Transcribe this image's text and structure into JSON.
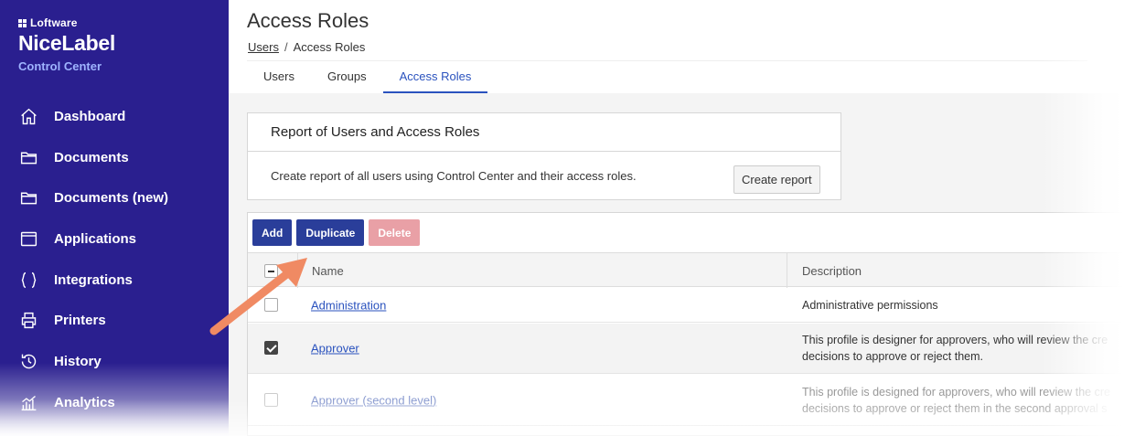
{
  "brand": {
    "company": "Loftware",
    "product": "NiceLabel",
    "subtitle": "Control Center"
  },
  "sidebar": {
    "items": [
      {
        "label": "Dashboard",
        "icon": "home-icon"
      },
      {
        "label": "Documents",
        "icon": "folder-icon"
      },
      {
        "label": "Documents (new)",
        "icon": "folder-icon"
      },
      {
        "label": "Applications",
        "icon": "window-icon"
      },
      {
        "label": "Integrations",
        "icon": "braces-icon"
      },
      {
        "label": "Printers",
        "icon": "printer-icon"
      },
      {
        "label": "History",
        "icon": "history-icon"
      },
      {
        "label": "Analytics",
        "icon": "analytics-icon"
      }
    ]
  },
  "header": {
    "title": "Access Roles",
    "breadcrumb": {
      "parent": "Users",
      "separator": "/",
      "current": "Access Roles"
    }
  },
  "tabs": [
    {
      "label": "Users",
      "active": false
    },
    {
      "label": "Groups",
      "active": false
    },
    {
      "label": "Access Roles",
      "active": true
    }
  ],
  "report": {
    "title": "Report of Users and Access Roles",
    "description": "Create report of all users using Control Center and their access roles.",
    "button_label": "Create report"
  },
  "toolbar": {
    "add_label": "Add",
    "duplicate_label": "Duplicate",
    "delete_label": "Delete"
  },
  "grid": {
    "columns": {
      "name": "Name",
      "description": "Description"
    },
    "rows": [
      {
        "name": "Administration",
        "description": "Administrative permissions",
        "checked": false
      },
      {
        "name": "Approver",
        "description": "This profile is designer for approvers, who will review the cre decisions to approve or reject them.",
        "checked": true
      },
      {
        "name": "Approver (second level)",
        "description": "This profile is designed for approvers, who will review the cre decisions to approve or reject them in the second approval s",
        "checked": false
      }
    ]
  },
  "colors": {
    "sidebar_bg": "#2a1f8f",
    "accent": "#2a52be",
    "primary_button": "#2a3e9a",
    "disabled_button": "#e9a0a6",
    "annotation_arrow": "#f08a63"
  }
}
